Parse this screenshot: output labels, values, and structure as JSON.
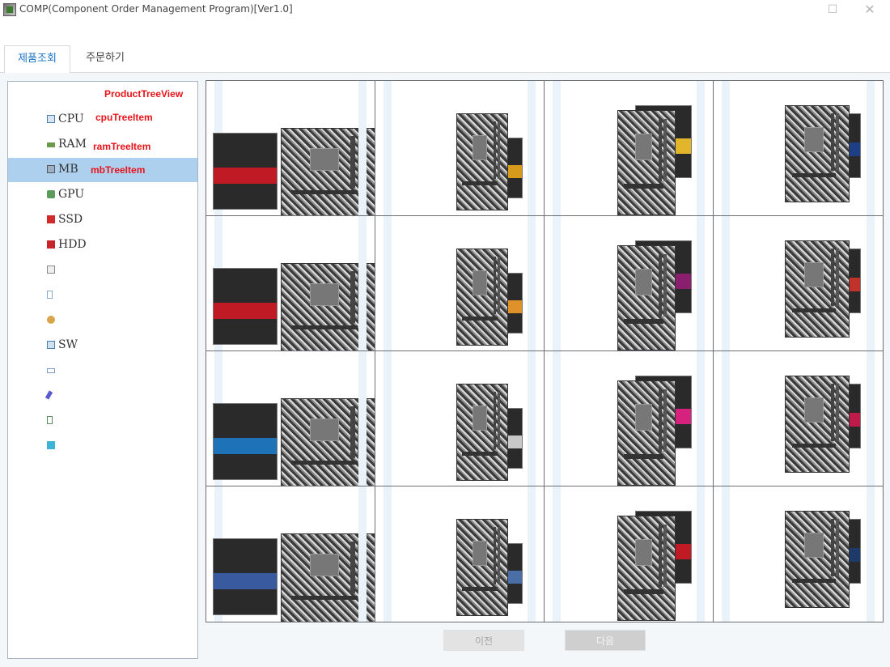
{
  "window": {
    "title": "COMP(Component Order Management Program)[Ver1.0]",
    "maximize_glyph": "☐",
    "close_glyph": "✕"
  },
  "tabs": [
    {
      "label": "제품조회",
      "active": true
    },
    {
      "label": "주문하기",
      "active": false
    }
  ],
  "annotations": {
    "tree_view": "ProductTreeView",
    "cpu_item": "cpuTreeItem",
    "ram_item": "ramTreeItem",
    "mb_item": "mbTreeItem"
  },
  "tree": {
    "items": [
      {
        "label": "",
        "icon": "root-icon"
      },
      {
        "label": "CPU",
        "icon": "cpu-icon"
      },
      {
        "label": "RAM",
        "icon": "ram-icon"
      },
      {
        "label": "MB",
        "icon": "motherboard-icon",
        "selected": true
      },
      {
        "label": "GPU",
        "icon": "gpu-icon"
      },
      {
        "label": "SSD",
        "icon": "ssd-icon"
      },
      {
        "label": "HDD",
        "icon": "hdd-icon"
      },
      {
        "label": "",
        "icon": "case-icon"
      },
      {
        "label": "",
        "icon": "power-icon"
      },
      {
        "label": "",
        "icon": "cooler-icon"
      },
      {
        "label": "SW",
        "icon": "software-icon"
      },
      {
        "label": "",
        "icon": "keyboard-icon"
      },
      {
        "label": "",
        "icon": "mouse-icon"
      },
      {
        "label": "",
        "icon": "speaker-icon"
      },
      {
        "label": "",
        "icon": "monitor-icon"
      }
    ]
  },
  "products": [
    {
      "icon": "motherboard-product-image",
      "accent": "#c01a25"
    },
    {
      "icon": "motherboard-product-image",
      "accent": "#d79a1a"
    },
    {
      "icon": "motherboard-product-image",
      "accent": "#e2b52b"
    },
    {
      "icon": "motherboard-product-image",
      "accent": "#1e3f86"
    },
    {
      "icon": "motherboard-product-image",
      "accent": "#c01a25"
    },
    {
      "icon": "motherboard-product-image",
      "accent": "#e0922a"
    },
    {
      "icon": "motherboard-product-image",
      "accent": "#8a1f6e"
    },
    {
      "icon": "motherboard-product-image",
      "accent": "#c0332b"
    },
    {
      "icon": "motherboard-product-image",
      "accent": "#1e73b8"
    },
    {
      "icon": "motherboard-product-image",
      "accent": "#c8c8c8"
    },
    {
      "icon": "motherboard-product-image",
      "accent": "#d6217e"
    },
    {
      "icon": "motherboard-product-image",
      "accent": "#c01a4a"
    },
    {
      "icon": "motherboard-product-image",
      "accent": "#3a5aa0"
    },
    {
      "icon": "motherboard-product-image",
      "accent": "#4a6fa5"
    },
    {
      "icon": "motherboard-product-image",
      "accent": "#c01a25"
    },
    {
      "icon": "motherboard-product-image",
      "accent": "#1d3a6b"
    }
  ],
  "buttons": {
    "prev": "이전",
    "next": "다음"
  },
  "colors": {
    "tab_active_text": "#1a73c9",
    "tree_selected": "#aed0ef",
    "annotation": "#e8131a"
  }
}
